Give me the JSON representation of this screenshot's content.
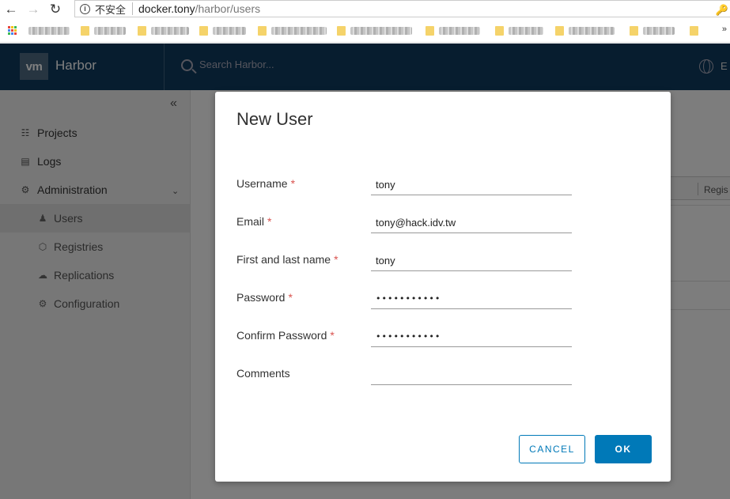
{
  "browser": {
    "back_icon": "arrow-left",
    "forward_icon": "arrow-right",
    "reload_icon": "reload",
    "security_label": "不安全",
    "url_host": "docker.tony",
    "url_path": "/harbor/users"
  },
  "bookmarks_more": "»",
  "app": {
    "logo": "vm",
    "title": "Harbor",
    "search_placeholder": "Search Harbor...",
    "lang_text": "E",
    "header_color": "#0f3b5e"
  },
  "sidebar": {
    "items": [
      {
        "label": "Projects",
        "icon": "projects-icon"
      },
      {
        "label": "Logs",
        "icon": "logs-icon"
      },
      {
        "label": "Administration",
        "icon": "administration-icon"
      }
    ],
    "sub_items": [
      {
        "label": "Users",
        "icon": "users-icon"
      },
      {
        "label": "Registries",
        "icon": "registries-icon"
      },
      {
        "label": "Replications",
        "icon": "replications-icon"
      },
      {
        "label": "Configuration",
        "icon": "configuration-icon"
      }
    ]
  },
  "content": {
    "column_label": "Regis"
  },
  "modal": {
    "title": "New User",
    "fields": [
      {
        "label": "Username",
        "required": "*",
        "value": "tony"
      },
      {
        "label": "Email",
        "required": "*",
        "value": "tony@hack.idv.tw"
      },
      {
        "label": "First and last name",
        "required": "*",
        "value": "tony"
      },
      {
        "label": "Password",
        "required": "*",
        "value": "•••••••••••"
      },
      {
        "label": "Confirm Password",
        "required": "*",
        "value": "•••••••••••"
      },
      {
        "label": "Comments",
        "value": ""
      }
    ],
    "cancel_label": "CANCEL",
    "ok_label": "OK",
    "accent_color": "#0079b8",
    "required_color": "#d9534f"
  }
}
